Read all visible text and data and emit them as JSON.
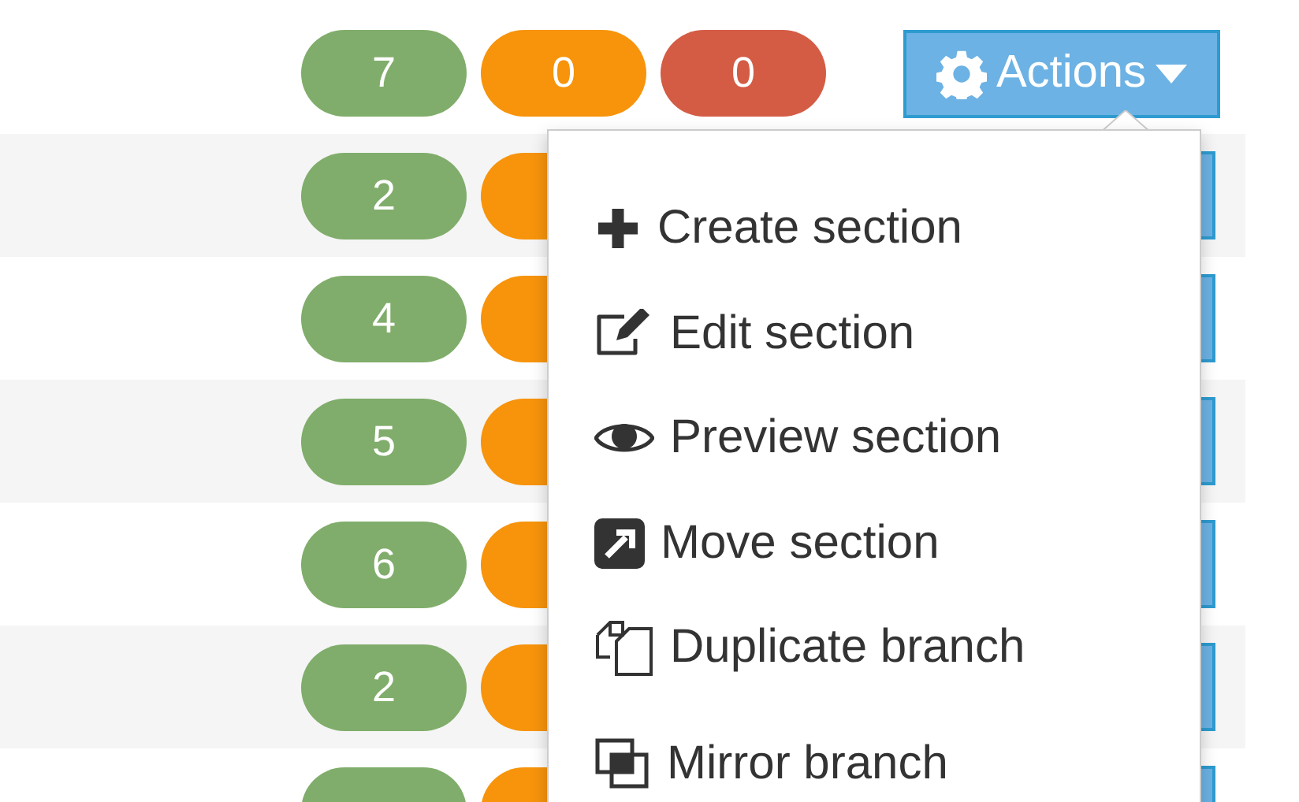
{
  "rows": [
    {
      "counts": [
        "7",
        "0",
        "0"
      ],
      "action": "Actions"
    },
    {
      "counts": [
        "2"
      ]
    },
    {
      "counts": [
        "4"
      ]
    },
    {
      "counts": [
        "5"
      ]
    },
    {
      "counts": [
        "6"
      ]
    },
    {
      "counts": [
        "2"
      ]
    },
    {
      "counts": []
    }
  ],
  "menu": {
    "items": [
      {
        "kind": "plus",
        "label": "Create section"
      },
      {
        "kind": "edit",
        "label": "Edit section"
      },
      {
        "kind": "eye",
        "label": "Preview section"
      },
      {
        "kind": "move",
        "label": "Move section"
      },
      {
        "kind": "duplicate",
        "label": "Duplicate branch"
      },
      {
        "kind": "mirror",
        "label": "Mirror branch"
      }
    ]
  }
}
